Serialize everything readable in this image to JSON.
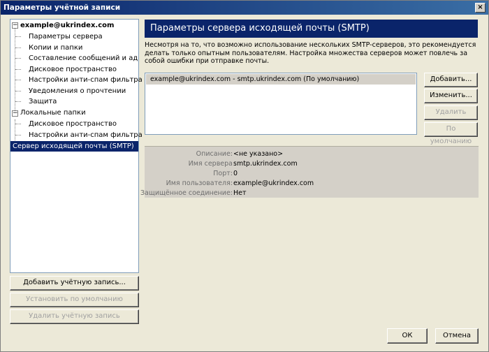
{
  "window": {
    "title": "Параметры учётной записи",
    "close_glyph": "×"
  },
  "tree": {
    "account": "example@ukrindex.com",
    "account_items": [
      "Параметры сервера",
      "Копии и папки",
      "Составление сообщений и адре...",
      "Дисковое пространство",
      "Настройки анти-спам фильтра",
      "Уведомления о прочтении",
      "Защита"
    ],
    "local": "Локальные папки",
    "local_items": [
      "Дисковое пространство",
      "Настройки анти-спам фильтра"
    ],
    "smtp": "Сервер исходящей почты (SMTP)"
  },
  "left_buttons": {
    "add_account": "Добавить учётную запись...",
    "set_default": "Установить по умолчанию",
    "delete_account": "Удалить учётную запись"
  },
  "main": {
    "header": "Параметры сервера исходящей почты (SMTP)",
    "description": "Несмотря на то, что возможно использование нескольких SMTP-серверов, это рекомендуется делать только опытным пользователям. Настройка множества серверов может повлечь за собой ошибки при отправке почты.",
    "servers": [
      "example@ukrindex.com - smtp.ukrindex.com (По умолчанию)"
    ],
    "buttons": {
      "add": "Добавить...",
      "edit": "Изменить...",
      "delete": "Удалить",
      "default": "По умолчанию"
    },
    "details": {
      "description_label": "Описание:",
      "description_value": "<не указано>",
      "server_label": "Имя сервера",
      "server_value": "smtp.ukrindex.com",
      "port_label": "Порт:",
      "port_value": "0",
      "user_label": "Имя пользователя:",
      "user_value": "example@ukrindex.com",
      "secure_label": "Защищённое соединение:",
      "secure_value": "Нет"
    }
  },
  "footer": {
    "ok": "ОК",
    "cancel": "Отмена"
  },
  "colors": {
    "selection": "#0a246a",
    "background": "#ece9d8"
  }
}
